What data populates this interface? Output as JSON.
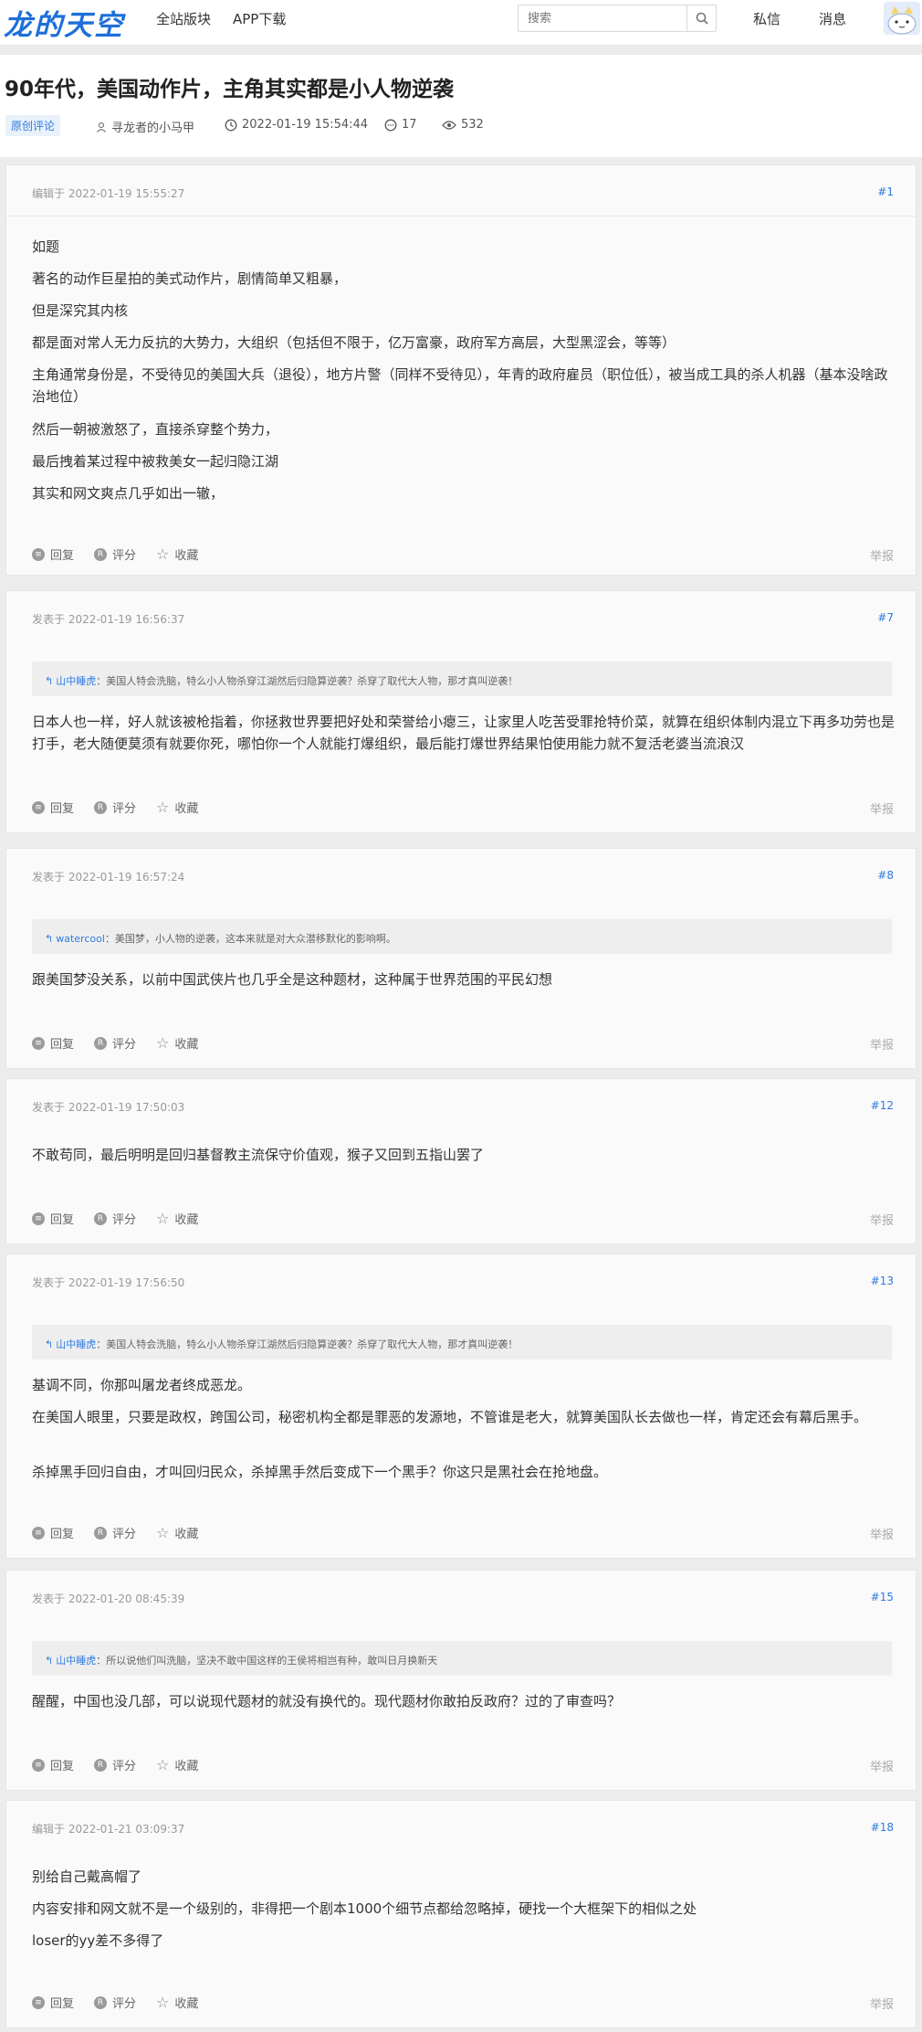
{
  "header": {
    "logo": "龙的天空",
    "nav": [
      "全站版块",
      "APP下载"
    ],
    "search_placeholder": "搜索",
    "right_links": [
      "私信",
      "消息"
    ]
  },
  "thread": {
    "title": "90年代，美国动作片，主角其实都是小人物逆袭",
    "badge": "原创评论",
    "author": "寻龙者的小马甲",
    "time": "2022-01-19 15:54:44",
    "replies": "17",
    "views": "532"
  },
  "actions": {
    "reply": "回复",
    "rate": "评分",
    "fav": "收藏",
    "report": "举报"
  },
  "posts": [
    {
      "head": "编辑于 2022-01-19 15:55:27",
      "floor": "#1",
      "paras": [
        "如题",
        "著名的动作巨星拍的美式动作片，剧情简单又粗暴，",
        "但是深究其内核",
        "都是面对常人无力反抗的大势力，大组织（包括但不限于，亿万富豪，政府军方高层，大型黑涩会，等等）",
        "主角通常身份是，不受待见的美国大兵（退役），地方片警（同样不受待见），年青的政府雇员（职位低），被当成工具的杀人机器（基本没啥政治地位）",
        "然后一朝被激怒了，直接杀穿整个势力，",
        "最后拽着某过程中被救美女一起归隐江湖",
        "其实和网文爽点几乎如出一辙，"
      ]
    },
    {
      "head": "发表于 2022-01-19 16:56:37",
      "floor": "#7",
      "quote_name": "山中睡虎",
      "quote_text": "：美国人特会洗脑，特么小人物杀穿江湖然后归隐算逆袭？杀穿了取代大人物，那才真叫逆袭！",
      "paras": [
        "日本人也一样，好人就该被枪指着，你拯救世界要把好处和荣誉给小瘪三，让家里人吃苦受罪抢特价菜，就算在组织体制内混立下再多功劳也是打手，老大随便莫须有就要你死，哪怕你一个人就能打爆组织，最后能打爆世界结果怕使用能力就不复活老婆当流浪汉"
      ]
    },
    {
      "head": "发表于 2022-01-19 16:57:24",
      "floor": "#8",
      "quote_name": "watercool",
      "quote_text": "：美国梦，小人物的逆袭，这本来就是对大众潜移默化的影响啊。",
      "paras": [
        "跟美国梦没关系，以前中国武侠片也几乎全是这种题材，这种属于世界范围的平民幻想"
      ]
    },
    {
      "head": "发表于 2022-01-19 17:50:03",
      "floor": "#12",
      "paras": [
        "不敢苟同，最后明明是回归基督教主流保守价值观，猴子又回到五指山罢了"
      ]
    },
    {
      "head": "发表于 2022-01-19 17:56:50",
      "floor": "#13",
      "quote_name": "山中睡虎",
      "quote_text": "：美国人特会洗脑，特么小人物杀穿江湖然后归隐算逆袭？杀穿了取代大人物，那才真叫逆袭！",
      "paras": [
        "基调不同，你那叫屠龙者终成恶龙。",
        "在美国人眼里，只要是政权，跨国公司，秘密机构全都是罪恶的发源地，不管谁是老大，就算美国队长去做也一样，肯定还会有幕后黑手。",
        "杀掉黑手回归自由，才叫回归民众，杀掉黑手然后变成下一个黑手？你这只是黑社会在抢地盘。"
      ]
    },
    {
      "head": "发表于 2022-01-20 08:45:39",
      "floor": "#15",
      "quote_name": "山中睡虎",
      "quote_text": "：所以说他们叫洗脑，坚决不敢中国这样的王侯将相岂有种，敢叫日月换新天",
      "paras": [
        "醒醒，中国也没几部，可以说现代题材的就没有换代的。现代题材你敢拍反政府？过的了审查吗？"
      ]
    },
    {
      "head": "编辑于 2022-01-21 03:09:37",
      "floor": "#18",
      "paras": [
        "别给自己戴高帽了",
        "内容安排和网文就不是一个级别的，非得把一个剧本1000个细节点都给忽略掉，硬找一个大框架下的相似之处",
        "loser的yy差不多得了"
      ]
    }
  ]
}
